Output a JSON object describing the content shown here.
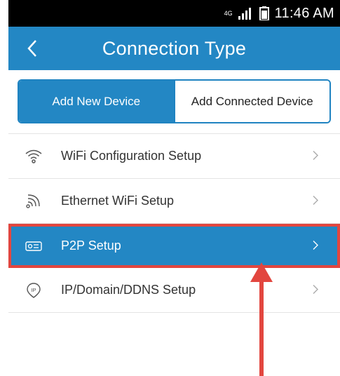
{
  "status_bar": {
    "time": "11:46 AM",
    "network_label": "4G"
  },
  "app_bar": {
    "title": "Connection Type",
    "back_icon": "chevron-left-icon"
  },
  "segment": {
    "tabs": [
      {
        "label": "Add New Device",
        "active": true
      },
      {
        "label": "Add Connected Device",
        "active": false
      }
    ]
  },
  "list": {
    "items": [
      {
        "label": "WiFi Configuration Setup",
        "icon": "wifi-icon",
        "selected": false
      },
      {
        "label": "Ethernet WiFi Setup",
        "icon": "signal-waves-icon",
        "selected": false
      },
      {
        "label": "P2P Setup",
        "icon": "p2p-card-icon",
        "selected": true
      },
      {
        "label": "IP/Domain/DDNS Setup",
        "icon": "ip-icon",
        "selected": false
      }
    ]
  },
  "colors": {
    "accent": "#2387c4",
    "highlight_border": "#e2463f",
    "annotation": "#e2463f"
  }
}
